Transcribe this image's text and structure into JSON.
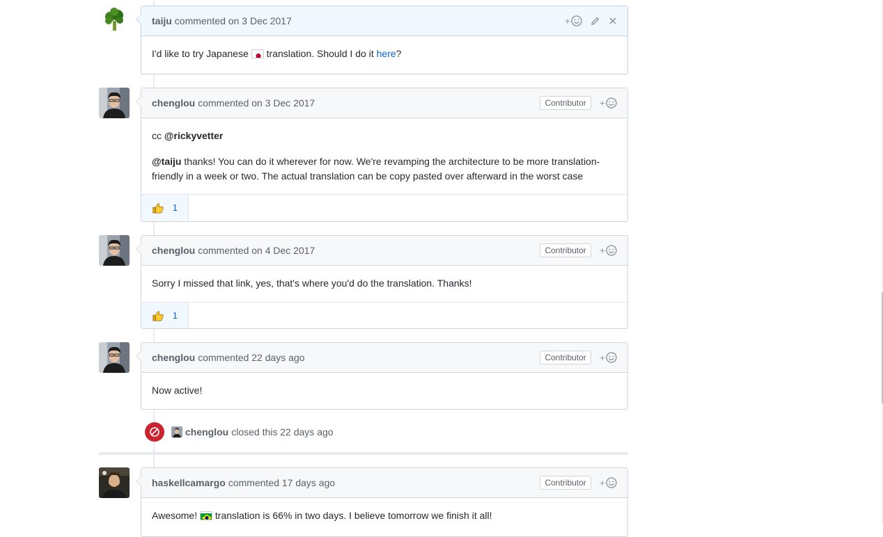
{
  "comments": [
    {
      "author": "taiju",
      "meta": "commented on 3 Dec 2017",
      "text_before": "I'd like to try Japanese ",
      "text_after": " translation. Should I do it ",
      "link": "here",
      "end": "?"
    },
    {
      "author": "chenglou",
      "meta": "commented on 3 Dec 2017",
      "badge": "Contributor",
      "cc_prefix": "cc ",
      "cc_mention": "@rickyvetter",
      "mention": "@taiju",
      "text": " thanks! You can do it wherever for now. We're revamping the architecture to be more translation-friendly in a week or two. The actual translation can be copy pasted over afterward in the worst case",
      "reaction_count": "1"
    },
    {
      "author": "chenglou",
      "meta": "commented on 4 Dec 2017",
      "badge": "Contributor",
      "text": "Sorry I missed that link, yes, that's where you'd do the translation. Thanks!",
      "reaction_count": "1"
    },
    {
      "author": "chenglou",
      "meta": "commented 22 days ago",
      "badge": "Contributor",
      "text": "Now active!"
    },
    {
      "author": "haskellcamargo",
      "meta": "commented 17 days ago",
      "badge": "Contributor",
      "text_before": "Awesome! ",
      "text_after": " translation is 66% in two days. I believe tomorrow we finish it all!"
    }
  ],
  "event": {
    "actor": "chenglou",
    "text": "closed this 22 days ago"
  },
  "reaction_plus": "+",
  "colors": {
    "link": "#0366d6",
    "closed": "#cb2431",
    "header_bg": "#f6f8fa",
    "own_header_bg": "#f1f8ff"
  },
  "icons": [
    "broccoli-avatar",
    "smiley-icon",
    "pencil-icon",
    "close-icon",
    "thumbs-up-icon",
    "closed-icon",
    "japan-flag-icon",
    "brazil-flag-icon"
  ]
}
